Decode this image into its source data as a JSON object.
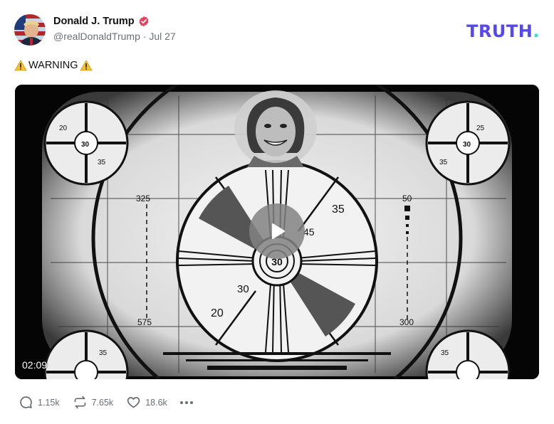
{
  "post": {
    "display_name": "Donald J. Trump",
    "handle": "@realDonaldTrump",
    "separator": "·",
    "date": "Jul 27",
    "verified_icon": "verified-badge-icon",
    "text": "WARNING"
  },
  "brand": {
    "logo_main": "TRUTH",
    "logo_dot": ".",
    "primary_color": "#5448ee",
    "accent_color": "#2ee8c4"
  },
  "video": {
    "duration": "02:09",
    "test_pattern_labels": {
      "left_top": "325",
      "left_bottom": "575",
      "right_top": "50",
      "right_bottom": "300",
      "center": "30",
      "ring_a": "35",
      "ring_b": "45",
      "ring_c": "30",
      "ring_d": "20",
      "corner_a": "20",
      "corner_b": "25",
      "corner_c": "30",
      "corner_d": "35"
    }
  },
  "actions": {
    "replies": "1.15k",
    "retruths": "7.65k",
    "likes": "18.6k"
  }
}
